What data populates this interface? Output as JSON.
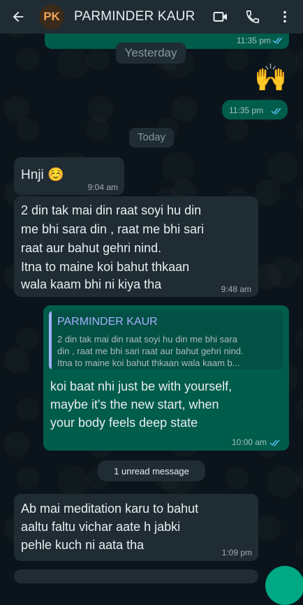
{
  "header": {
    "avatar_initials": "PK",
    "contact_name": "PARMINDER KAUR",
    "icons": [
      "back-arrow-icon",
      "video-call-icon",
      "phone-icon",
      "more-vert-icon"
    ]
  },
  "messages": {
    "top_partial_time": "11:35 pm",
    "date_yesterday": "Yesterday",
    "emoji_message": "🙌",
    "emoji_time": "11:35 pm",
    "date_today": "Today",
    "hnji_text": "Hnji ☺️",
    "hnji_time": "9:04 am",
    "long_in_line1": "2 din tak mai din raat soyi hu din",
    "long_in_line2": "me bhi sara din , raat me bhi sari",
    "long_in_line3": "raat aur bahut gehri nind.",
    "long_in_line4": "Itna to maine koi bahut thkaan",
    "long_in_line5": "wala kaam bhi ni kiya tha",
    "long_in_time": "9:48 am",
    "quote_name": "PARMINDER KAUR",
    "quote_line1": "2 din tak mai din raat soyi hu din me bhi sara",
    "quote_line2": "din , raat me bhi sari raat aur bahut gehri nind.",
    "quote_line3": "Itna to maine koi bahut thkaan wala kaam b...",
    "reply_line1": "koi baat nhi just be with yourself,",
    "reply_line2": "maybe it's the new start, when",
    "reply_line3": "your body feels deep state",
    "reply_time": "10:00 am",
    "unread_label": "1 unread message",
    "last_line1": "Ab mai meditation karu to bahut",
    "last_line2": "aaltu faltu vichar aate h jabki",
    "last_line3": "pehle kuch ni aata tha",
    "last_time": "1:09 pm"
  },
  "colors": {
    "background": "#0b141a",
    "header": "#1f2c34",
    "outgoing": "#005c4b",
    "incoming": "#1f2c34",
    "quote_accent": "#a5b1ff",
    "read_ticks": "#53bdeb"
  }
}
